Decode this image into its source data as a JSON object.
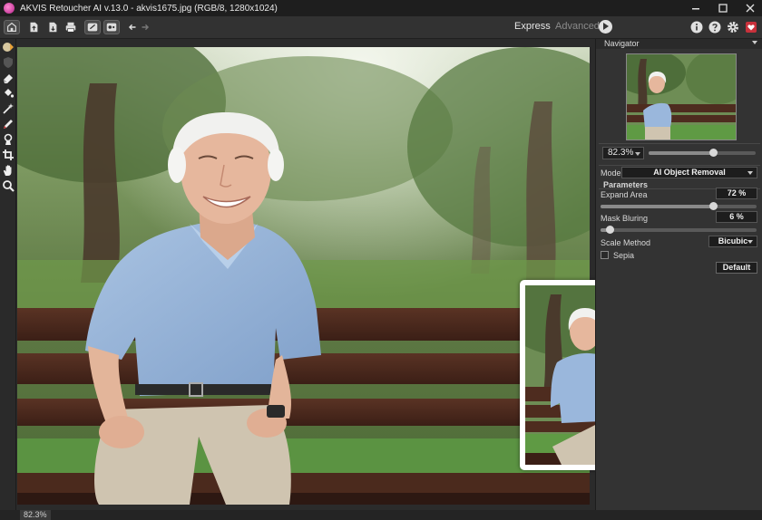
{
  "window": {
    "title": "AKVIS Retoucher AI v.13.0 - akvis1675.jpg (RGB/8, 1280x1024)",
    "controls": [
      "help-icon",
      "minimize-icon",
      "maximize-icon",
      "close-icon"
    ]
  },
  "toolbar": {
    "left_icons": [
      "home-icon",
      "open-file-icon",
      "save-file-icon",
      "print-icon",
      "share-icon",
      "plugins-icon",
      "undo-icon",
      "redo-icon"
    ],
    "mode_express": "Express",
    "mode_advanced": "Advanced",
    "right_icons": [
      "play-run-icon",
      "info-icon",
      "help-icon",
      "settings-icon",
      "donate-icon"
    ]
  },
  "tools": [
    "remove-object-icon",
    "mask-shield-icon",
    "eraser-icon",
    "fill-bucket-icon",
    "magic-wand-icon",
    "pencil-icon",
    "clone-stamp-icon",
    "crop-icon",
    "hand-icon",
    "zoom-icon"
  ],
  "navigator": {
    "title": "Navigator",
    "zoom_value": "82.3%",
    "zoom_level": 0.6
  },
  "settings": {
    "mode_label": "Mode:",
    "mode_value": "AI Object Removal",
    "parameters_title": "Parameters",
    "expand_area_label": "Expand Area",
    "expand_area_value": "72 %",
    "expand_area_level": 0.72,
    "mask_blurring_label": "Mask Bluring",
    "mask_blurring_value": "6 %",
    "mask_blurring_level": 0.06,
    "scale_method_label": "Scale Method",
    "scale_method_value": "Bicubic",
    "sepia_label": "Sepia",
    "sepia_checked": false,
    "default_button": "Default"
  },
  "status": {
    "zoom": "82.3%"
  },
  "colors": {
    "background": "#2b2b2b",
    "panel": "#333333",
    "accent_red": "#c8313b"
  }
}
